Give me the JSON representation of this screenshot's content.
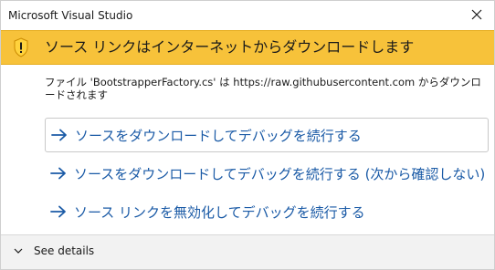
{
  "window": {
    "title": "Microsoft Visual Studio"
  },
  "banner": {
    "headline": "ソース リンクはインターネットからダウンロードします",
    "accent_color": "#f7c23a",
    "icon": "warning-icon"
  },
  "message": {
    "text": "ファイル 'BootstrapperFactory.cs' は https://raw.githubusercontent.com からダウンロードされます"
  },
  "options": [
    {
      "label": "ソースをダウンロードしてデバッグを続行する",
      "icon": "arrow-right-icon"
    },
    {
      "label": "ソースをダウンロードしてデバッグを続行する (次から確認しない)",
      "icon": "arrow-right-icon"
    },
    {
      "label": "ソース リンクを無効化してデバッグを続行する",
      "icon": "arrow-right-icon"
    }
  ],
  "footer": {
    "details_label": "See details",
    "icon": "chevron-down-icon"
  },
  "colors": {
    "link": "#1a5aa6",
    "footer_bg": "#f2f2f2"
  }
}
